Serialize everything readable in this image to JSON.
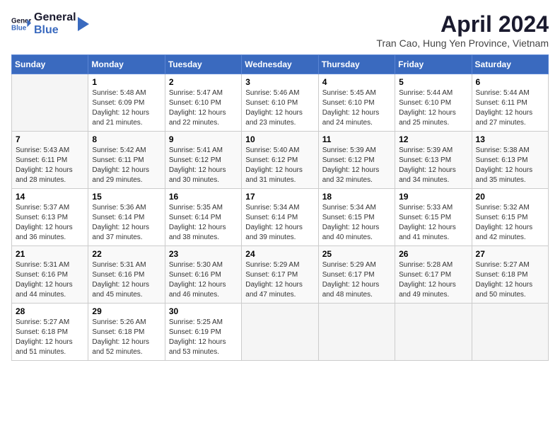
{
  "header": {
    "logo_line1": "General",
    "logo_line2": "Blue",
    "title": "April 2024",
    "subtitle": "Tran Cao, Hung Yen Province, Vietnam"
  },
  "weekdays": [
    "Sunday",
    "Monday",
    "Tuesday",
    "Wednesday",
    "Thursday",
    "Friday",
    "Saturday"
  ],
  "weeks": [
    [
      {
        "day": "",
        "info": ""
      },
      {
        "day": "1",
        "info": "Sunrise: 5:48 AM\nSunset: 6:09 PM\nDaylight: 12 hours\nand 21 minutes."
      },
      {
        "day": "2",
        "info": "Sunrise: 5:47 AM\nSunset: 6:10 PM\nDaylight: 12 hours\nand 22 minutes."
      },
      {
        "day": "3",
        "info": "Sunrise: 5:46 AM\nSunset: 6:10 PM\nDaylight: 12 hours\nand 23 minutes."
      },
      {
        "day": "4",
        "info": "Sunrise: 5:45 AM\nSunset: 6:10 PM\nDaylight: 12 hours\nand 24 minutes."
      },
      {
        "day": "5",
        "info": "Sunrise: 5:44 AM\nSunset: 6:10 PM\nDaylight: 12 hours\nand 25 minutes."
      },
      {
        "day": "6",
        "info": "Sunrise: 5:44 AM\nSunset: 6:11 PM\nDaylight: 12 hours\nand 27 minutes."
      }
    ],
    [
      {
        "day": "7",
        "info": "Sunrise: 5:43 AM\nSunset: 6:11 PM\nDaylight: 12 hours\nand 28 minutes."
      },
      {
        "day": "8",
        "info": "Sunrise: 5:42 AM\nSunset: 6:11 PM\nDaylight: 12 hours\nand 29 minutes."
      },
      {
        "day": "9",
        "info": "Sunrise: 5:41 AM\nSunset: 6:12 PM\nDaylight: 12 hours\nand 30 minutes."
      },
      {
        "day": "10",
        "info": "Sunrise: 5:40 AM\nSunset: 6:12 PM\nDaylight: 12 hours\nand 31 minutes."
      },
      {
        "day": "11",
        "info": "Sunrise: 5:39 AM\nSunset: 6:12 PM\nDaylight: 12 hours\nand 32 minutes."
      },
      {
        "day": "12",
        "info": "Sunrise: 5:39 AM\nSunset: 6:13 PM\nDaylight: 12 hours\nand 34 minutes."
      },
      {
        "day": "13",
        "info": "Sunrise: 5:38 AM\nSunset: 6:13 PM\nDaylight: 12 hours\nand 35 minutes."
      }
    ],
    [
      {
        "day": "14",
        "info": "Sunrise: 5:37 AM\nSunset: 6:13 PM\nDaylight: 12 hours\nand 36 minutes."
      },
      {
        "day": "15",
        "info": "Sunrise: 5:36 AM\nSunset: 6:14 PM\nDaylight: 12 hours\nand 37 minutes."
      },
      {
        "day": "16",
        "info": "Sunrise: 5:35 AM\nSunset: 6:14 PM\nDaylight: 12 hours\nand 38 minutes."
      },
      {
        "day": "17",
        "info": "Sunrise: 5:34 AM\nSunset: 6:14 PM\nDaylight: 12 hours\nand 39 minutes."
      },
      {
        "day": "18",
        "info": "Sunrise: 5:34 AM\nSunset: 6:15 PM\nDaylight: 12 hours\nand 40 minutes."
      },
      {
        "day": "19",
        "info": "Sunrise: 5:33 AM\nSunset: 6:15 PM\nDaylight: 12 hours\nand 41 minutes."
      },
      {
        "day": "20",
        "info": "Sunrise: 5:32 AM\nSunset: 6:15 PM\nDaylight: 12 hours\nand 42 minutes."
      }
    ],
    [
      {
        "day": "21",
        "info": "Sunrise: 5:31 AM\nSunset: 6:16 PM\nDaylight: 12 hours\nand 44 minutes."
      },
      {
        "day": "22",
        "info": "Sunrise: 5:31 AM\nSunset: 6:16 PM\nDaylight: 12 hours\nand 45 minutes."
      },
      {
        "day": "23",
        "info": "Sunrise: 5:30 AM\nSunset: 6:16 PM\nDaylight: 12 hours\nand 46 minutes."
      },
      {
        "day": "24",
        "info": "Sunrise: 5:29 AM\nSunset: 6:17 PM\nDaylight: 12 hours\nand 47 minutes."
      },
      {
        "day": "25",
        "info": "Sunrise: 5:29 AM\nSunset: 6:17 PM\nDaylight: 12 hours\nand 48 minutes."
      },
      {
        "day": "26",
        "info": "Sunrise: 5:28 AM\nSunset: 6:17 PM\nDaylight: 12 hours\nand 49 minutes."
      },
      {
        "day": "27",
        "info": "Sunrise: 5:27 AM\nSunset: 6:18 PM\nDaylight: 12 hours\nand 50 minutes."
      }
    ],
    [
      {
        "day": "28",
        "info": "Sunrise: 5:27 AM\nSunset: 6:18 PM\nDaylight: 12 hours\nand 51 minutes."
      },
      {
        "day": "29",
        "info": "Sunrise: 5:26 AM\nSunset: 6:18 PM\nDaylight: 12 hours\nand 52 minutes."
      },
      {
        "day": "30",
        "info": "Sunrise: 5:25 AM\nSunset: 6:19 PM\nDaylight: 12 hours\nand 53 minutes."
      },
      {
        "day": "",
        "info": ""
      },
      {
        "day": "",
        "info": ""
      },
      {
        "day": "",
        "info": ""
      },
      {
        "day": "",
        "info": ""
      }
    ]
  ]
}
